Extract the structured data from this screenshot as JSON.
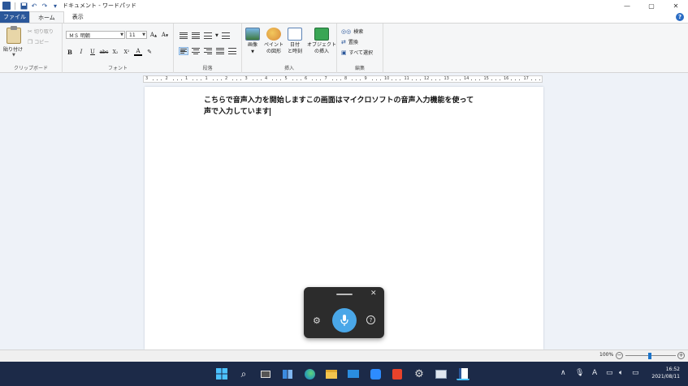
{
  "window": {
    "title": "ドキュメント - ワードパッド",
    "minimize": "—",
    "maximize": "▢",
    "close": "✕"
  },
  "menu": {
    "file": "ファイル",
    "home": "ホーム",
    "view": "表示",
    "help": "?"
  },
  "ribbon": {
    "clipboard": {
      "paste": "貼り付け",
      "cut": "切り取り",
      "copy": "コピー",
      "label": "クリップボード"
    },
    "font": {
      "family": "ＭＳ 明朝",
      "size": "11",
      "bold": "B",
      "italic": "I",
      "underline": "U",
      "strike": "abc",
      "subscript": "X₂",
      "superscript": "X²",
      "color": "A",
      "label": "フォント"
    },
    "paragraph": {
      "label": "段落"
    },
    "insert": {
      "picture": "画像",
      "paint": "ペイント\nの図形",
      "datetime": "日付\nと時刻",
      "object": "オブジェクト\nの挿入",
      "label": "挿入"
    },
    "editing": {
      "find": "検索",
      "replace": "置換",
      "select_all": "すべて選択",
      "label": "編集"
    }
  },
  "ruler": {
    "numbers": [
      "3",
      "2",
      "1",
      "1",
      "2",
      "3",
      "4",
      "5",
      "6",
      "7",
      "8",
      "9",
      "10",
      "11",
      "12",
      "13",
      "14",
      "15",
      "16",
      "17"
    ]
  },
  "document": {
    "line1": "こちらで音声入力を開始しますこの画面はマイクロソフトの音声入力機能を使って",
    "line2": "声で入力しています"
  },
  "status": {
    "zoom": "100%"
  },
  "taskbar": {
    "time": "16:52",
    "date": "2021/08/11",
    "ime": "A"
  },
  "colors": {
    "accent": "#2b579a",
    "taskbar": "#1c2a48",
    "mic": "#4aa7e8"
  }
}
